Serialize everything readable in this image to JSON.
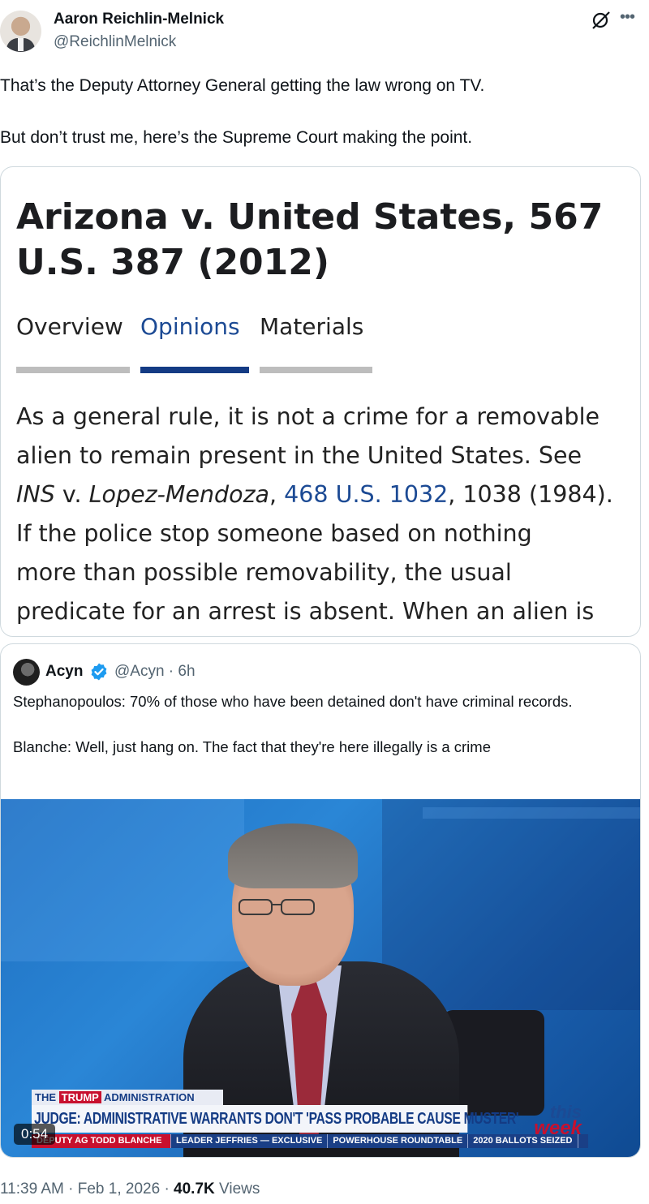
{
  "author": {
    "name": "Aaron Reichlin-Melnick",
    "handle": "@ReichlinMelnick"
  },
  "tweet": {
    "paragraphs": [
      "That’s the Deputy Attorney General getting the law wrong on TV.",
      "But don’t trust me, here’s the Supreme Court making the point."
    ]
  },
  "case_card": {
    "title": "Arizona v. United States, 567 U.S. 387 (2012)",
    "tabs": [
      {
        "label": "Overview",
        "active": false
      },
      {
        "label": "Opinions",
        "active": true
      },
      {
        "label": "Materials",
        "active": false
      }
    ],
    "body": {
      "line1": "As a general rule, it is not a crime for a removable",
      "line2": "alien to remain present in the United States. See",
      "ins": "INS",
      "v": " v. ",
      "case_name": "Lopez-Mendoza",
      "comma": ", ",
      "citation_link": "468 U.S. 1032",
      "cite_rest": ", 1038 (1984).",
      "line4": "If the police stop someone based on nothing",
      "line5": "more than possible removability, the usual",
      "line6": "predicate for an arrest is absent. When an alien is"
    },
    "colors": {
      "link": "#1c4a94",
      "active_tab_bar": "#143b84",
      "tab_bar": "#bdbdbd"
    }
  },
  "quote": {
    "name": "Acyn",
    "handle_time": "@Acyn · 6h",
    "paragraphs": [
      "Stephanopoulos: 70% of those who have been detained don't have criminal records.",
      "Blanche: Well, just hang on. The fact that they're here illegally is a crime"
    ],
    "video": {
      "duration": "0:54",
      "lower_third": {
        "prefix": "THE",
        "red_word": "TRUMP",
        "suffix": "ADMINISTRATION",
        "headline": "JUDGE: ADMINISTRATIVE WARRANTS DON'T 'PASS PROBABLE CAUSE MUSTER'",
        "logo_top": "this",
        "logo_bottom": "week",
        "ticker": [
          "DEPUTY AG TODD BLANCHE",
          "LEADER JEFFRIES — EXCLUSIVE",
          "POWERHOUSE ROUNDTABLE",
          "2020 BALLOTS SEIZED"
        ]
      }
    }
  },
  "meta": {
    "time_date": "11:39 AM · Feb 1, 2026 · ",
    "views_count": "40.7K",
    "views_label": " Views"
  },
  "icons": {
    "grok": "grok-icon",
    "more": "more-icon",
    "verified": "verified-icon",
    "verified_color": "#1d9bf0"
  }
}
